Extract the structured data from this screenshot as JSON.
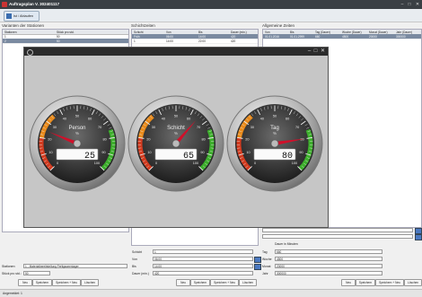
{
  "window": {
    "title": "Auftragsplan V. 302401117",
    "minimize": "–",
    "maximize": "□",
    "close": "✕"
  },
  "toolbar": {
    "button_label": "Ist / Ablaufen"
  },
  "left": {
    "section_title": "Varianten der Stationen",
    "columns": [
      "Stationen",
      "Stück pro std."
    ],
    "rows": [
      [
        "1",
        "50"
      ],
      [
        "2",
        "50"
      ]
    ],
    "selected_row": 1,
    "station_label": "Stationen:",
    "station_value": "1 - Materialbereitstellung Fertigwarenlager",
    "pieces_label": "Stück pro std.:",
    "pieces_value": "50",
    "buttons": [
      "Neu",
      "Speichern",
      "Speichern + Neu",
      "Löschen"
    ]
  },
  "middle": {
    "section_title": "Schichtzeiten",
    "columns": [
      "Schicht",
      "Von",
      "Bis",
      "Dauer (min.)"
    ],
    "rows": [
      [
        "Früh",
        "06:00",
        "14:00",
        "420"
      ],
      [
        "1",
        "14:00",
        "22:00",
        "420"
      ]
    ],
    "selected_row": 0,
    "form": [
      {
        "label": "Schicht",
        "value": "1"
      },
      {
        "label": "Von",
        "value": "06:00"
      },
      {
        "label": "Bis",
        "value": "14:00"
      },
      {
        "label": "Dauer (min.)",
        "value": "420"
      }
    ],
    "buttons": [
      "Neu",
      "Speichern",
      "Speichern + Neu",
      "Löschen"
    ]
  },
  "right": {
    "section_title": "Allgemeine Zeiten",
    "columns": [
      "Von",
      "Bis",
      "Tag (Dauer)",
      "Woche (Dauer)",
      "Monat (Dauer)",
      "Jahr (Dauer)"
    ],
    "rows": [
      [
        "01.01.2016",
        "01.01.2999",
        "660",
        "4500",
        "20000",
        "300000"
      ]
    ],
    "selected_row": 0,
    "unit_note": "Dauer in Minuten",
    "form": [
      {
        "label": "Tag",
        "value": "660"
      },
      {
        "label": "Woche",
        "value": "4500"
      },
      {
        "label": "Monat",
        "value": "20000"
      },
      {
        "label": "Jahr",
        "value": "300000"
      }
    ],
    "buttons": [
      "Neu",
      "Speichern",
      "Speichern + Neu",
      "Löschen"
    ]
  },
  "gauges": [
    {
      "name": "gauge-person",
      "label": "Person",
      "unit": "%",
      "value": 25,
      "display": "25"
    },
    {
      "name": "gauge-schicht",
      "label": "Schicht",
      "unit": "%",
      "value": 65,
      "display": "65"
    },
    {
      "name": "gauge-tag",
      "label": "Tag",
      "unit": "%",
      "value": 80,
      "display": "80"
    }
  ],
  "gauge_scale": {
    "min": 0,
    "max": 100,
    "tick_labels": [
      "0",
      "10",
      "20",
      "30",
      "40",
      "50",
      "60",
      "70",
      "80",
      "90",
      "100"
    ]
  },
  "colors": {
    "title_bar": "#3a3f44",
    "selection": "#7a8aa0",
    "zone_red": "#d23b1f",
    "zone_orange": "#e98a1a",
    "zone_green": "#3cae2b",
    "needle": "#d0102a",
    "accent": "#4a78c0"
  },
  "status": {
    "text": "Angemeldet: 1"
  }
}
